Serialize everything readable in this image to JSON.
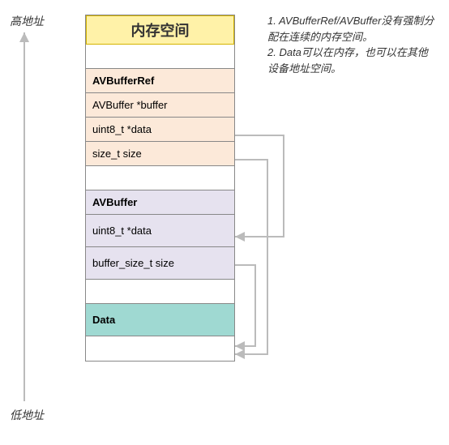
{
  "labels": {
    "high": "高地址",
    "low": "低地址"
  },
  "title": "内存空间",
  "struct1": {
    "name": "AVBufferRef",
    "fields": [
      "AVBuffer *buffer",
      "uint8_t *data",
      "size_t  size"
    ]
  },
  "struct2": {
    "name": "AVBuffer",
    "fields": [
      "uint8_t *data",
      "buffer_size_t size"
    ]
  },
  "data_block": "Data",
  "notes": {
    "line1": "1. AVBufferRef/AVBuffer没有强制分配在连续的内存空间。",
    "line2": "2. Data可以在内存，也可以在其他设备地址空间。"
  }
}
